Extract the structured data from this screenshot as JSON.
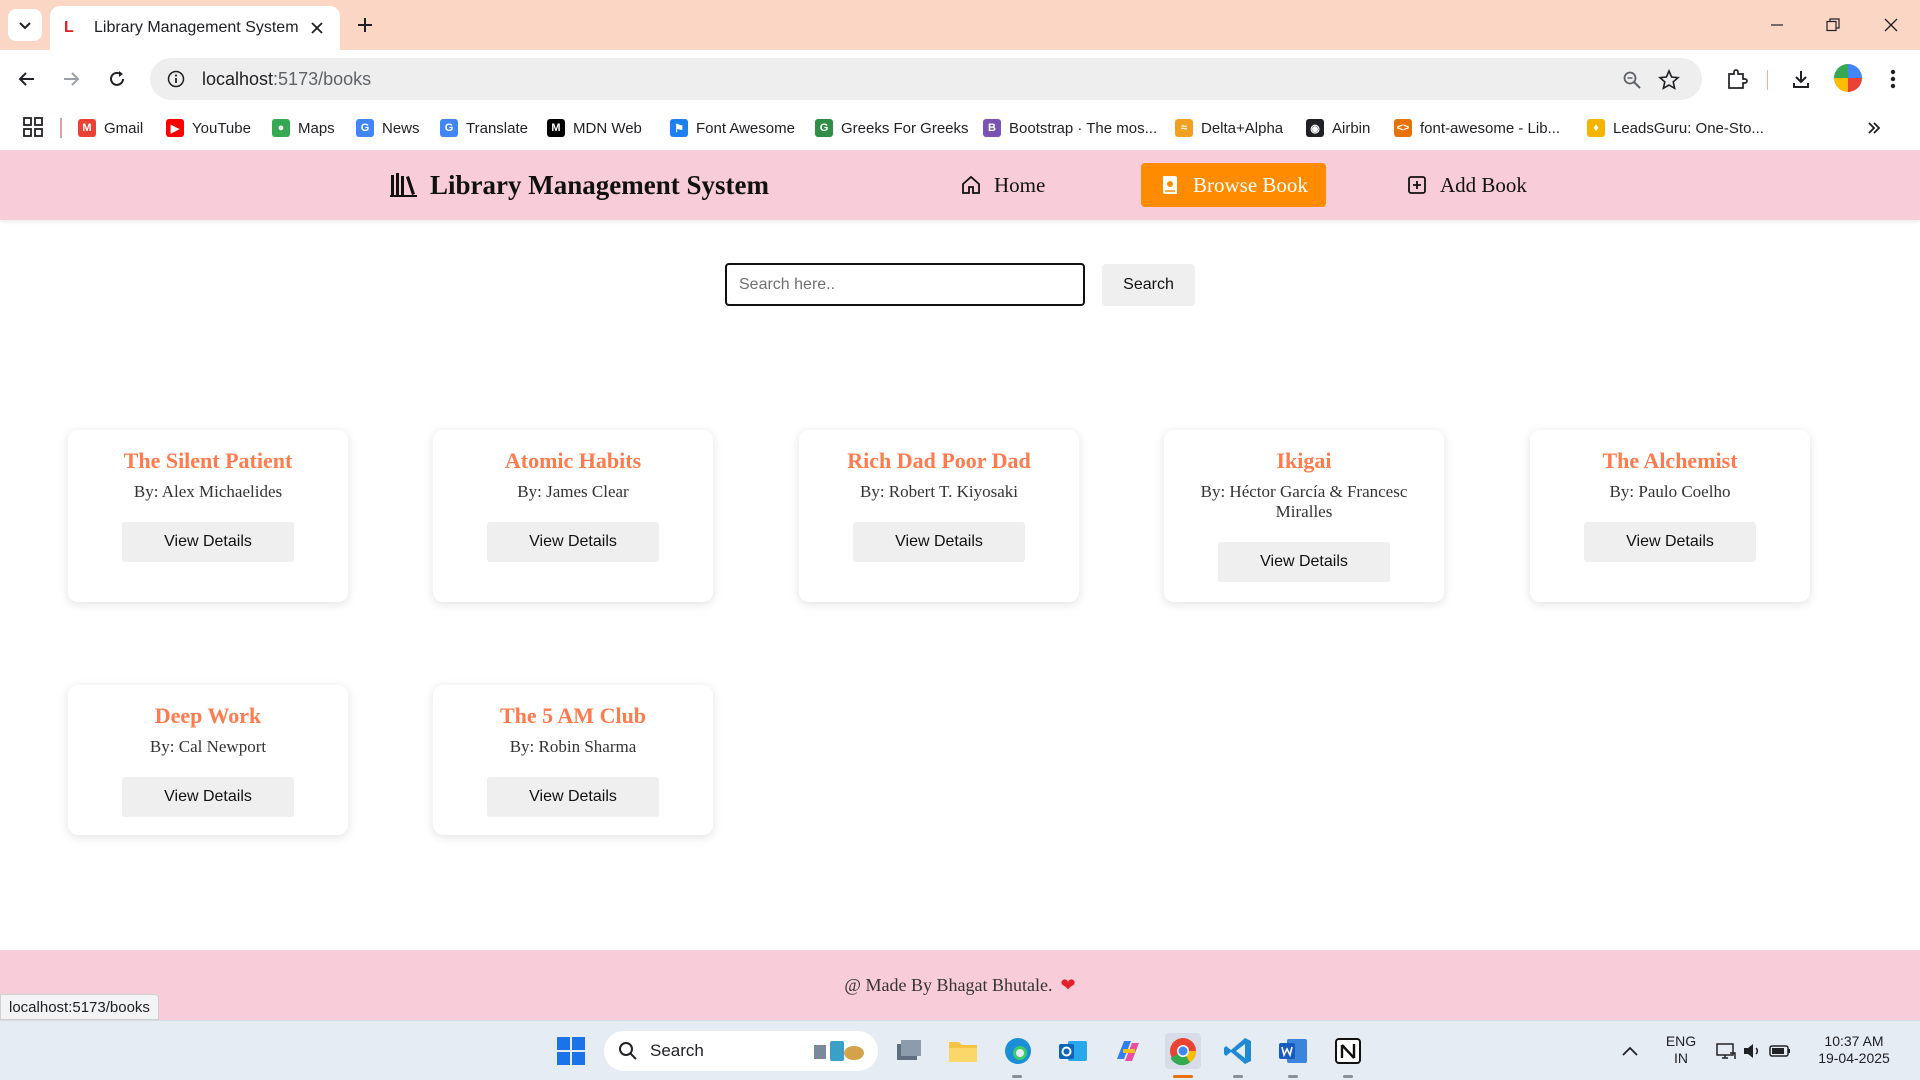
{
  "browser": {
    "tab_title": "Library Management System",
    "url_host": "localhost",
    "url_path": ":5173/books",
    "status_url": "localhost:5173/books"
  },
  "bookmarks": [
    {
      "label": "Gmail",
      "icon": "gmail-icon",
      "color": "#ea4335",
      "glyph": "M"
    },
    {
      "label": "YouTube",
      "icon": "youtube-icon",
      "color": "#ff0000",
      "glyph": "▶"
    },
    {
      "label": "Maps",
      "icon": "maps-icon",
      "color": "#34a853",
      "glyph": "●"
    },
    {
      "label": "News",
      "icon": "news-icon",
      "color": "#4285f4",
      "glyph": "G"
    },
    {
      "label": "Translate",
      "icon": "translate-icon",
      "color": "#4285f4",
      "glyph": "G"
    },
    {
      "label": "MDN Web",
      "icon": "mdn-icon",
      "color": "#000000",
      "glyph": "M"
    },
    {
      "label": "Font Awesome",
      "icon": "font-awesome-icon",
      "color": "#1d7ff0",
      "glyph": "⚑"
    },
    {
      "label": "Greeks For Greeks",
      "icon": "geeksforgeeks-icon",
      "color": "#2f8d46",
      "glyph": "G"
    },
    {
      "label": "Bootstrap · The mos...",
      "icon": "bootstrap-icon",
      "color": "#7952b3",
      "glyph": "B"
    },
    {
      "label": "Delta+Alpha",
      "icon": "delta-alpha-icon",
      "color": "#f0a020",
      "glyph": "≈"
    },
    {
      "label": "Airbin",
      "icon": "airbin-icon",
      "color": "#202124",
      "glyph": "◉"
    },
    {
      "label": "font-awesome - Lib...",
      "icon": "code-icon",
      "color": "#e8710a",
      "glyph": "<>"
    },
    {
      "label": "LeadsGuru: One-Sto...",
      "icon": "leadsguru-icon",
      "color": "#f4b400",
      "glyph": "♦"
    }
  ],
  "header": {
    "brand": "Library Management System",
    "nav": [
      {
        "label": "Home",
        "icon": "home-icon",
        "active": false
      },
      {
        "label": "Browse Book",
        "icon": "book-icon",
        "active": true
      },
      {
        "label": "Add Book",
        "icon": "plus-square-icon",
        "active": false
      }
    ],
    "accent_color": "#ff8c00",
    "header_bg": "#f8ccd8"
  },
  "search": {
    "placeholder": "Search here..",
    "value": "",
    "button_label": "Search"
  },
  "books": [
    {
      "title": "The Silent Patient",
      "author": "By: Alex Michaelides",
      "button": "View Details"
    },
    {
      "title": "Atomic Habits",
      "author": "By: James Clear",
      "button": "View Details"
    },
    {
      "title": "Rich Dad Poor Dad",
      "author": "By: Robert T. Kiyosaki",
      "button": "View Details"
    },
    {
      "title": "Ikigai",
      "author": "By: Héctor García & Francesc Miralles",
      "button": "View Details"
    },
    {
      "title": "The Alchemist",
      "author": "By: Paulo Coelho",
      "button": "View Details"
    },
    {
      "title": "Deep Work",
      "author": "By: Cal Newport",
      "button": "View Details"
    },
    {
      "title": "The 5 AM Club",
      "author": "By: Robin Sharma",
      "button": "View Details"
    }
  ],
  "footer": {
    "text": "@ Made By Bhagat Bhutale.",
    "heart": "❤"
  },
  "taskbar": {
    "search_label": "Search",
    "lang_top": "ENG",
    "lang_bottom": "IN",
    "time": "10:37 AM",
    "date": "19-04-2025"
  }
}
